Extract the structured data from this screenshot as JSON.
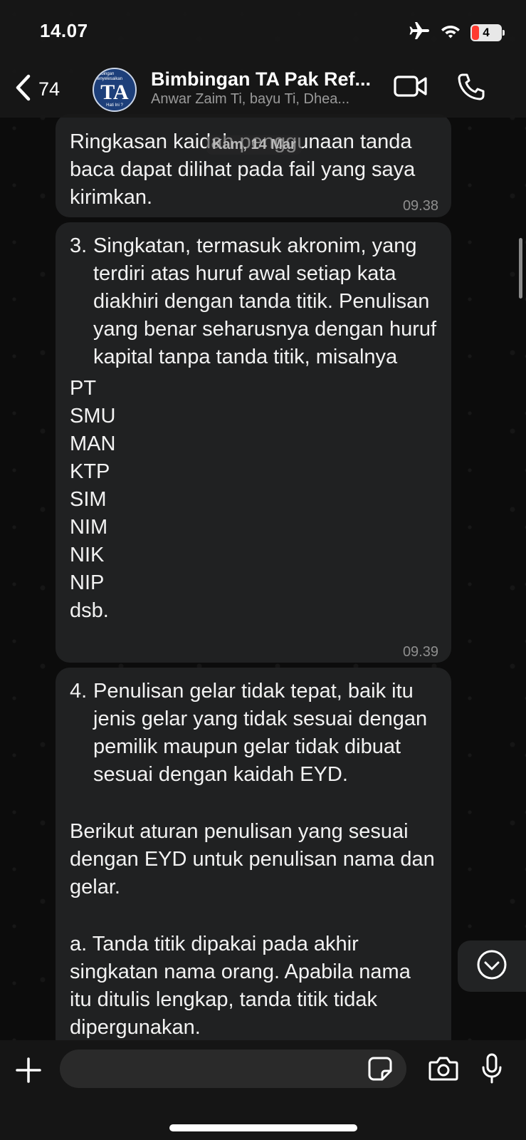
{
  "status_bar": {
    "time": "14.07",
    "battery_level": "4",
    "icons": [
      "airplane-icon",
      "wifi-icon",
      "battery-icon"
    ]
  },
  "header": {
    "back_count": "74",
    "avatar": {
      "top_text": "Bimbingan Menyelesaikan",
      "main_text": "TA",
      "bottom_text": "Hati Ini ?"
    },
    "title": "Bimbingan TA Pak Ref...",
    "subtitle": "Anwar Zaim Ti, bayu Ti, Dhea...",
    "icons": [
      "chevron-left-icon",
      "video-camera-icon",
      "phone-icon"
    ]
  },
  "date_chip": "Kam, 14 Mar",
  "messages": [
    {
      "text": "Ringkasan kaidah penggunaan tanda baca dapat dilihat pada fail yang saya kirimkan.",
      "time": "09.38"
    },
    {
      "item_number": "3.",
      "item_text": "Singkatan, termasuk akronim, yang terdiri atas huruf awal setiap kata diakhiri dengan tanda titik. Penulisan yang benar seharusnya dengan huruf kapital tanpa tanda titik, misalnya",
      "examples": [
        "PT",
        "SMU",
        "MAN",
        "KTP",
        "SIM",
        "NIM",
        "NIK",
        "NIP",
        "dsb."
      ],
      "time": "09.39"
    },
    {
      "item_number": "4.",
      "item_text": "Penulisan gelar tidak tepat, baik itu jenis gelar yang tidak sesuai dengan pemilik maupun gelar tidak dibuat sesuai dengan kaidah EYD.",
      "paragraph_1": "Berikut aturan penulisan yang sesuai dengan EYD untuk penulisan nama dan gelar.",
      "paragraph_2": "a. Tanda titik dipakai pada akhir singkatan nama orang. Apabila nama itu ditulis lengkap, tanda titik tidak dipergunakan."
    }
  ],
  "composer": {
    "placeholder": "",
    "icons": [
      "plus-icon",
      "sticker-icon",
      "camera-icon",
      "microphone-icon"
    ]
  },
  "colors": {
    "bubble": "#202122",
    "header": "#181818",
    "text": "#f2f2f2",
    "timestamp": "#8e8e8e",
    "battery_low": "#ff3b30"
  }
}
